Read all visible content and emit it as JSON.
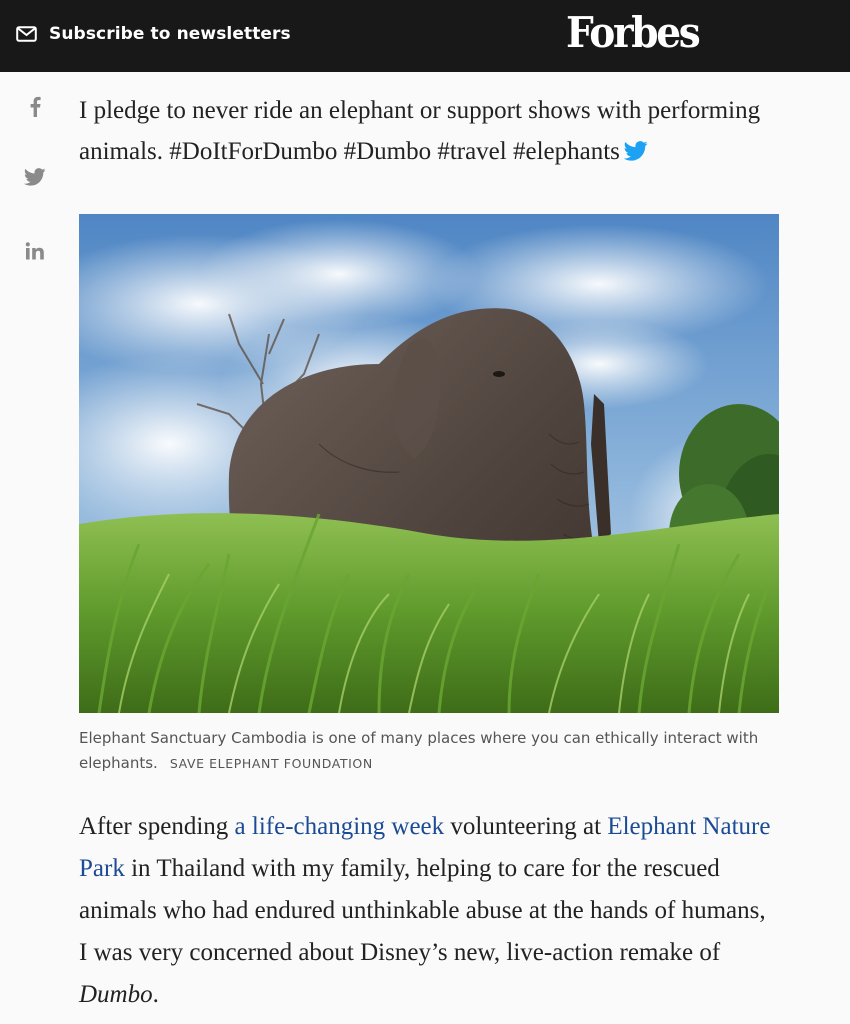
{
  "header": {
    "subscribe_label": "Subscribe to newsletters",
    "logo_text": "Forbes",
    "background_color": "#181818"
  },
  "share": {
    "items": [
      {
        "icon": "facebook-icon"
      },
      {
        "icon": "twitter-icon"
      },
      {
        "icon": "linkedin-icon"
      }
    ]
  },
  "tweet": {
    "text": "I pledge to never ride an elephant or support shows with performing animals. #DoItForDumbo #Dumbo #travel #elephants",
    "icon": "twitter-bird-icon",
    "icon_color": "#1da1f2"
  },
  "figure": {
    "caption": "Elephant Sanctuary Cambodia is one of many places where you can ethically interact with elephants.",
    "credit": "SAVE ELEPHANT FOUNDATION"
  },
  "article": {
    "p1_start": "After spending ",
    "p1_link1": "a life-changing week",
    "p1_mid": " volunteering at ",
    "p1_link2": "Elephant Nature Park",
    "p1_rest": " in Thailand with my family, helping to care for the rescued animals who had endured unthinkable abuse at the hands of humans, I was very concerned about Disney’s new, live-action remake of ",
    "p1_italic": "Dumbo",
    "p1_end": ".",
    "link_color": "#1b4b94"
  }
}
